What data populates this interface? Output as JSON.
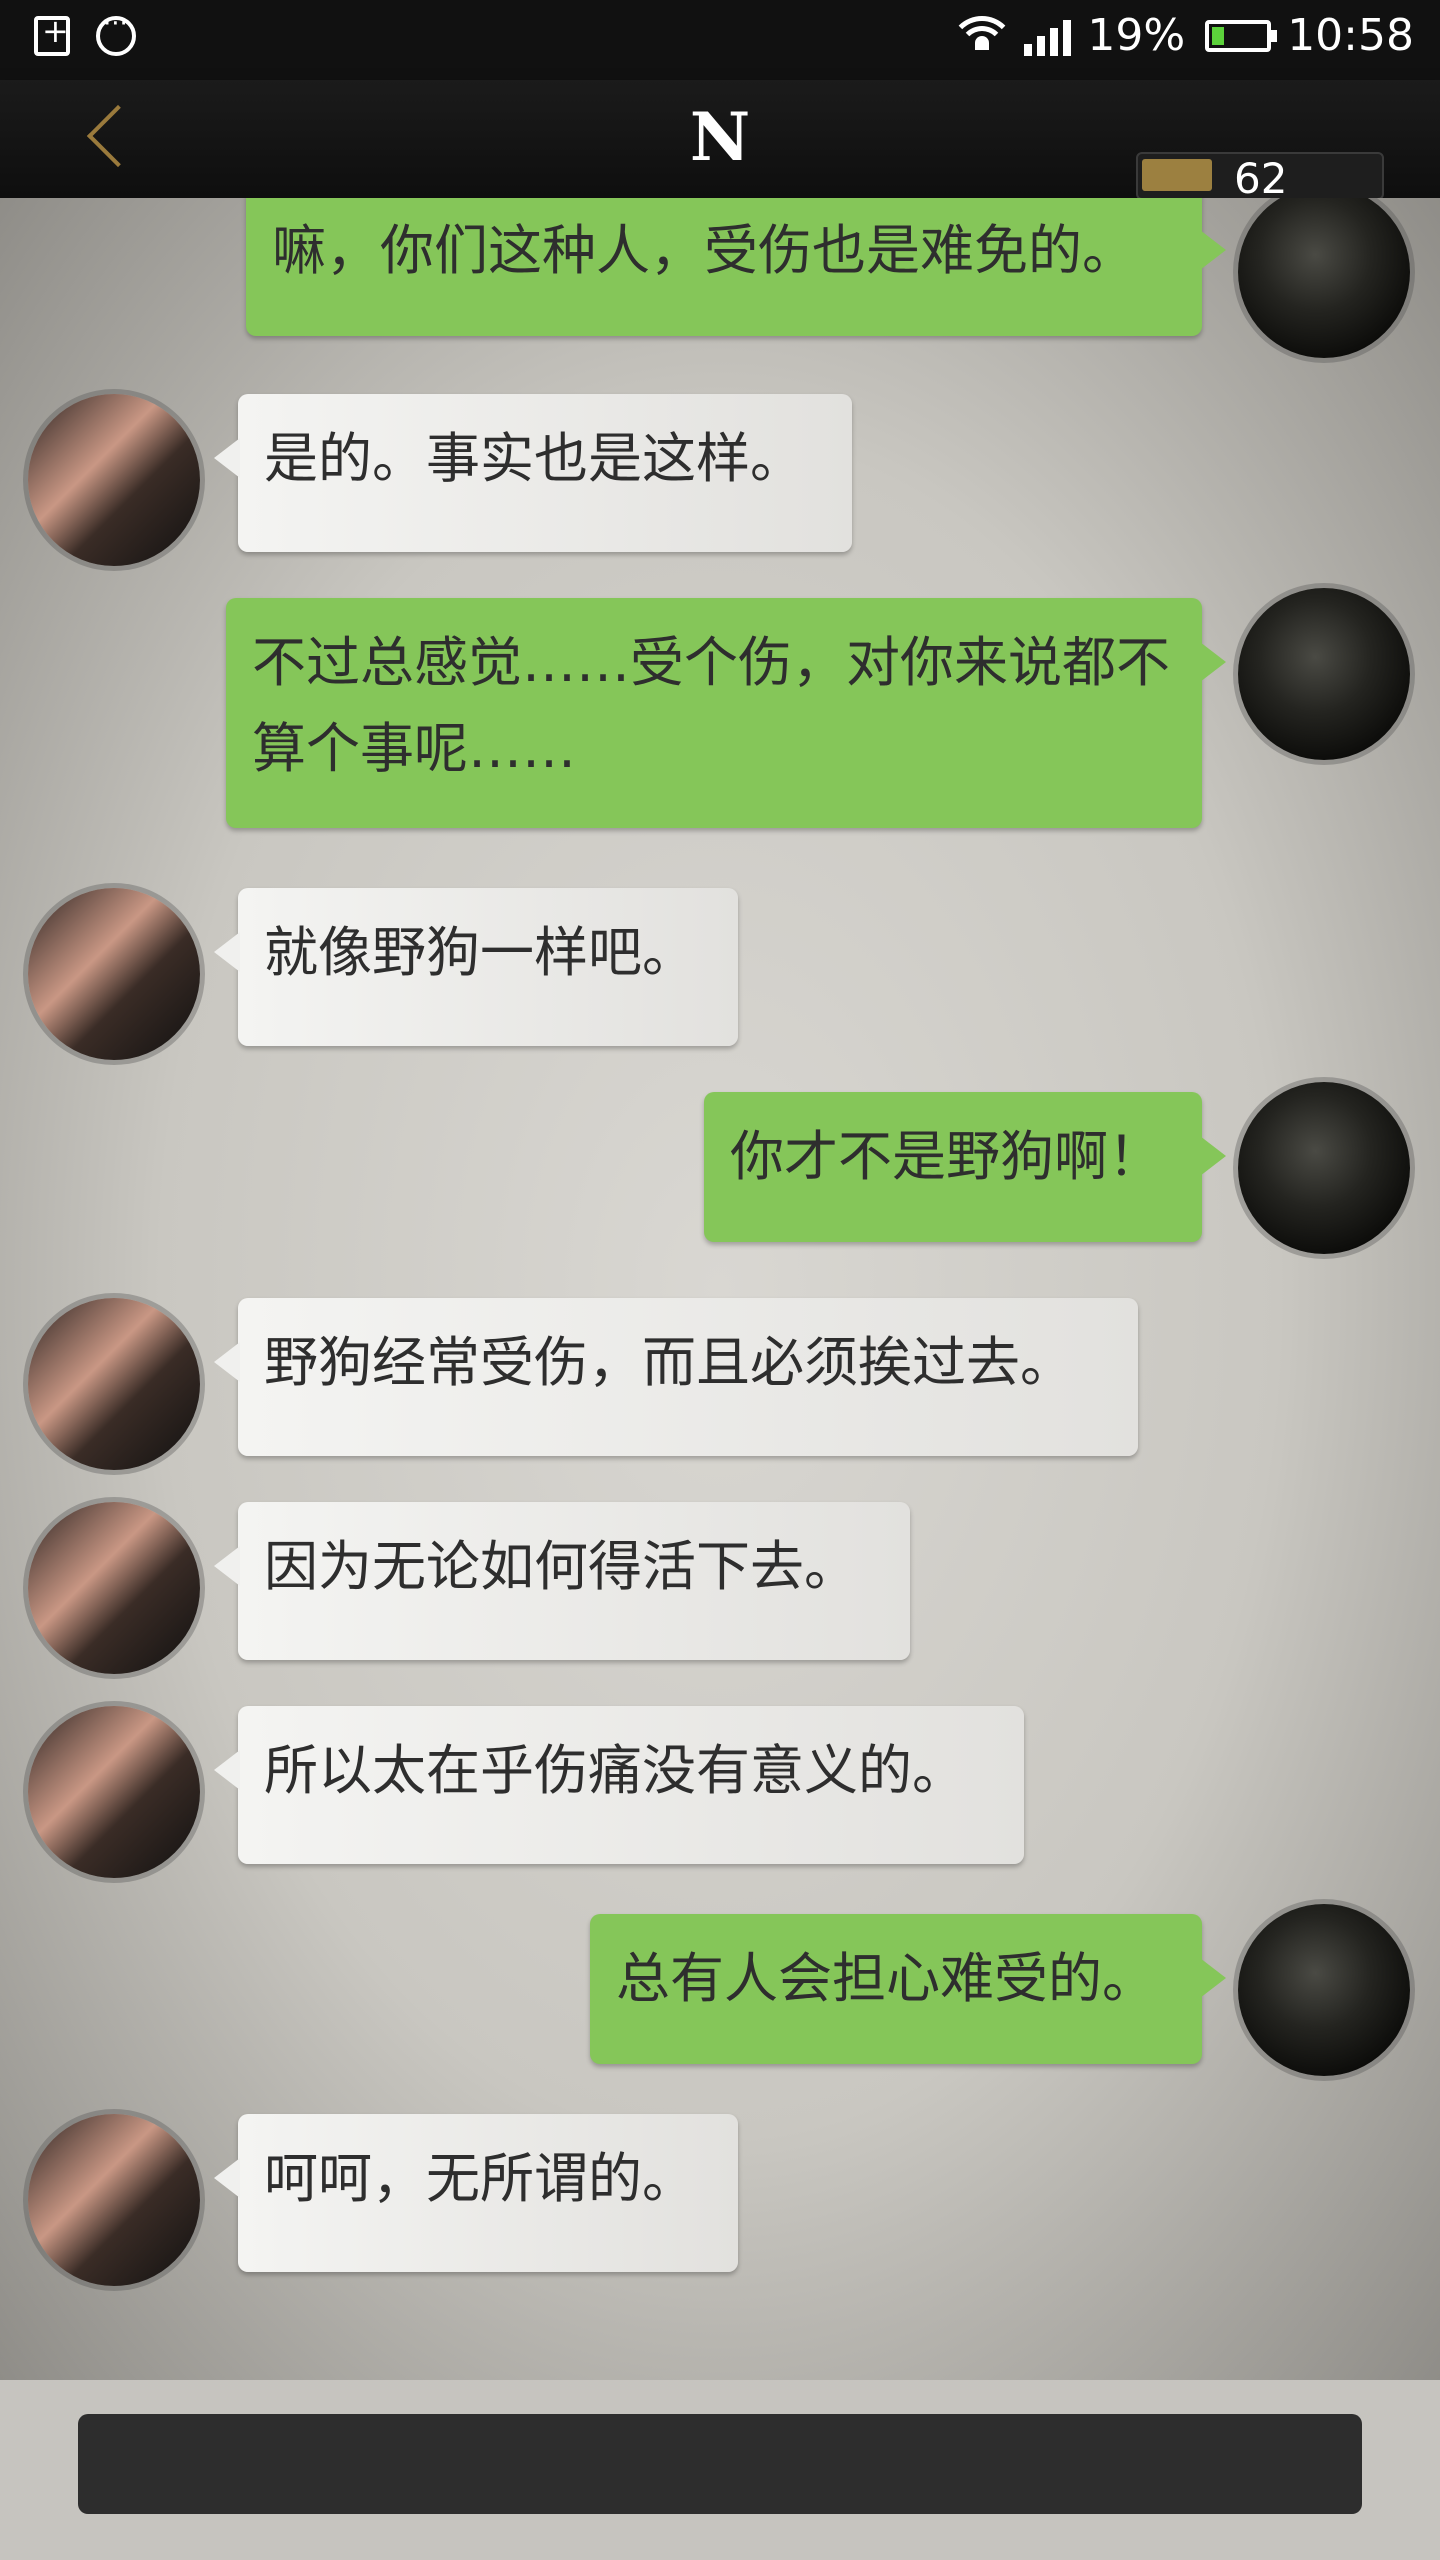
{
  "status": {
    "battery_percent": "19%",
    "time": "10:58",
    "battery_level": 0.19
  },
  "header": {
    "title": "N",
    "energy_value": "62"
  },
  "messages": [
    {
      "side": "self",
      "text": "嘛，你们这种人，受伤也是难免的。"
    },
    {
      "side": "other",
      "text": "是的。事实也是这样。"
    },
    {
      "side": "self",
      "text": "不过总感觉……受个伤，对你来说都不算个事呢……"
    },
    {
      "side": "other",
      "text": "就像野狗一样吧。"
    },
    {
      "side": "self",
      "text": "你才不是野狗啊！"
    },
    {
      "side": "other",
      "text": "野狗经常受伤，而且必须挨过去。"
    },
    {
      "side": "other",
      "text": "因为无论如何得活下去。"
    },
    {
      "side": "other",
      "text": "所以太在乎伤痛没有意义的。"
    },
    {
      "side": "self",
      "text": "总有人会担心难受的。"
    },
    {
      "side": "other",
      "text": "呵呵，无所谓的。"
    }
  ],
  "input": {
    "value": ""
  }
}
